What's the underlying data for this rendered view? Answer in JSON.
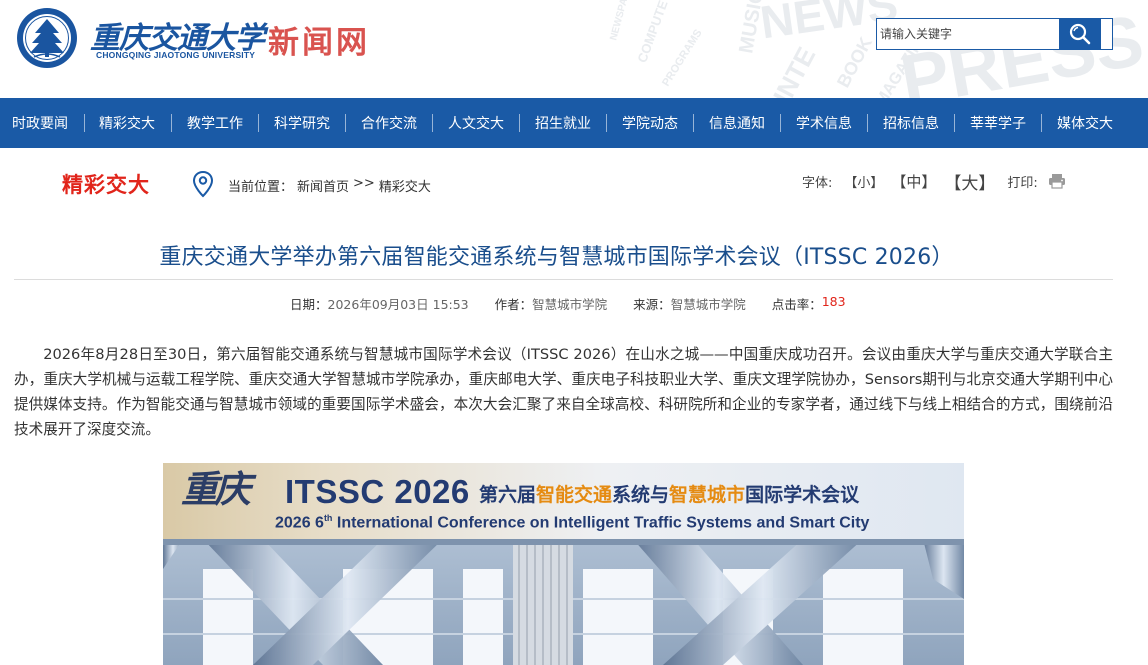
{
  "header": {
    "logo_cn": "重庆交通大学",
    "logo_en": "CHONGQING JIAOTONG UNIVERSITY",
    "site_name": "新闻网",
    "background_words": [
      "COMPUTE",
      "PROGRAMS",
      "NEWS",
      "BOOK",
      "INTE",
      "MAGAZINE",
      "PRESS",
      "MUSIC",
      "NEWSPAPER"
    ],
    "seal_ring_text": "CHONGQING JIAOTONG UNIVERSITY"
  },
  "search": {
    "placeholder": "请输入关键字",
    "value": "",
    "button_icon": "search-icon"
  },
  "nav": {
    "items": [
      {
        "label": "时政要闻"
      },
      {
        "label": "精彩交大"
      },
      {
        "label": "教学工作"
      },
      {
        "label": "科学研究"
      },
      {
        "label": "合作交流"
      },
      {
        "label": "人文交大"
      },
      {
        "label": "招生就业"
      },
      {
        "label": "学院动态"
      },
      {
        "label": "信息通知"
      },
      {
        "label": "学术信息"
      },
      {
        "label": "招标信息"
      },
      {
        "label": "莘莘学子"
      },
      {
        "label": "媒体交大"
      }
    ]
  },
  "location": {
    "section_title": "精彩交大",
    "icon": "location-pin-icon",
    "prefix": "当前位置：",
    "home": "新闻首页",
    "separator": ">>",
    "current": "精彩交大"
  },
  "tools": {
    "font_label": "字体:",
    "font_small": "【小】",
    "font_mid": "【中】",
    "font_big": "【大】",
    "print_label": "打印:",
    "print_icon": "printer-icon"
  },
  "article": {
    "title": "重庆交通大学举办第六届智能交通系统与智慧城市国际学术会议（ITSSC 2026）",
    "meta": {
      "date_label": "日期：",
      "date": "2026年09月03日 15:53",
      "author_label": "作者：",
      "author": "智慧城市学院",
      "source_label": "来源：",
      "source": "智慧城市学院",
      "hits_label": "点击率：",
      "hits": "183"
    },
    "paragraph": "2026年8月28日至30日，第六届智能交通系统与智慧城市国际学术会议（ITSSC 2026）在山水之城——中国重庆成功召开。会议由重庆大学与重庆交通大学联合主办，重庆大学机械与运载工程学院、重庆交通大学智慧城市学院承办，重庆邮电大学、重庆电子科技职业大学、重庆文理学院协办，Sensors期刊与北京交通大学期刊中心提供媒体支持。作为智能交通与智慧城市领域的重要国际学术盛会，本次大会汇聚了来自全球高校、科研院所和企业的专家学者，通过线下与线上相结合的方式，围绕前沿技术展开了深度交流。"
  },
  "photo": {
    "banner_city": "重庆",
    "banner_title": "ITSSC 2026",
    "banner_cn_a": "第六届",
    "banner_cn_hl1": "智能交通",
    "banner_cn_b": "系统与",
    "banner_cn_hl2": "智慧城市",
    "banner_cn_c": "国际学术会议",
    "banner_en_a": "2026 6",
    "banner_en_sup": "th",
    "banner_en_b": " International Conference on Intelligent Traffic Systems and Smart City"
  },
  "colors": {
    "brand_blue": "#1a5aa6",
    "title_blue": "#1a4e8c",
    "accent_red": "#e1251b",
    "site_name_red": "#d9534f",
    "banner_orange": "#e58b12"
  }
}
